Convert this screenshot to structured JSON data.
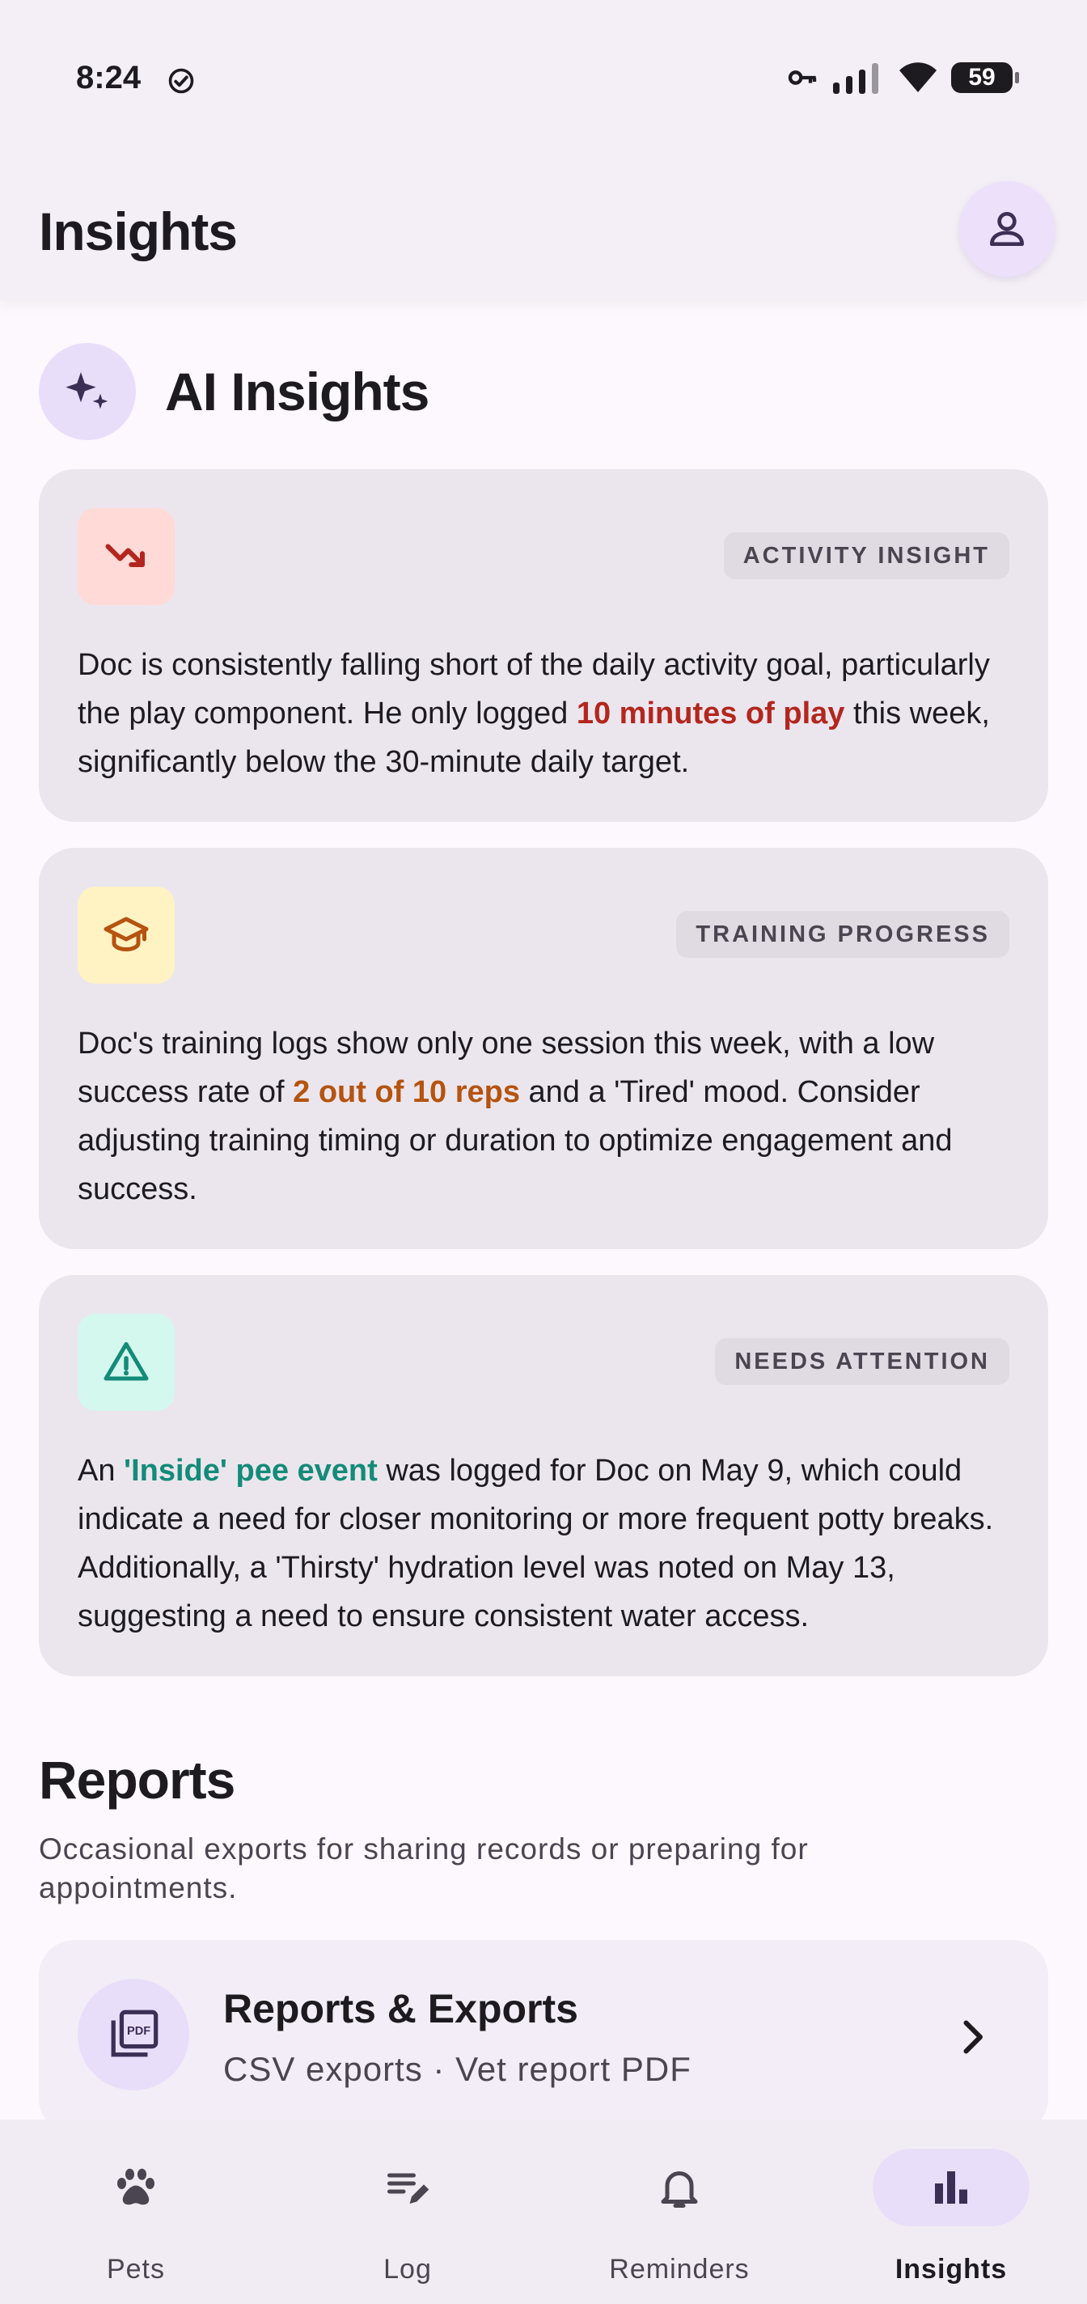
{
  "status_bar": {
    "time": "8:24",
    "battery": "59"
  },
  "app_bar": {
    "title": "Insights"
  },
  "ai_section": {
    "title": "AI Insights"
  },
  "insights": [
    {
      "badge": "ACTIVITY INSIGHT",
      "icon": "trending-down-icon",
      "text_before": "Doc is consistently falling short of the daily activity goal, particularly the play component. He only logged ",
      "highlight": "10 minutes of play",
      "text_after": " this week, significantly below the 30-minute daily target.",
      "icon_bg": "#ffdad6",
      "icon_color": "#b3261e"
    },
    {
      "badge": "TRAINING PROGRESS",
      "icon": "graduation-cap-icon",
      "text_before": "Doc's training logs show only one session this week, with a low success rate of ",
      "highlight": "2 out of 10 reps",
      "text_after": " and a 'Tired' mood. Consider adjusting training timing or duration to optimize engagement and success.",
      "icon_bg": "#fff3c4",
      "icon_color": "#b5530f"
    },
    {
      "badge": "NEEDS ATTENTION",
      "icon": "warning-triangle-icon",
      "text_before": "An ",
      "highlight": "'Inside' pee event",
      "text_after": " was logged for Doc on May 9, which could indicate a need for closer monitoring or more frequent potty breaks. Additionally, a 'Thirsty' hydration level was noted on May 13, suggesting a need to ensure consistent water access.",
      "icon_bg": "#d4f7ee",
      "icon_color": "#138b78"
    }
  ],
  "reports": {
    "title": "Reports",
    "subtitle": "Occasional exports for sharing records or preparing for appointments.",
    "card_title": "Reports & Exports",
    "card_subtitle": "CSV exports · Vet report PDF",
    "pdf_label": "PDF"
  },
  "bottom_nav": {
    "items": [
      {
        "label": "Pets",
        "icon": "paw-icon",
        "active": false
      },
      {
        "label": "Log",
        "icon": "edit-note-icon",
        "active": false
      },
      {
        "label": "Reminders",
        "icon": "bell-icon",
        "active": false
      },
      {
        "label": "Insights",
        "icon": "bar-chart-icon",
        "active": true
      }
    ]
  }
}
